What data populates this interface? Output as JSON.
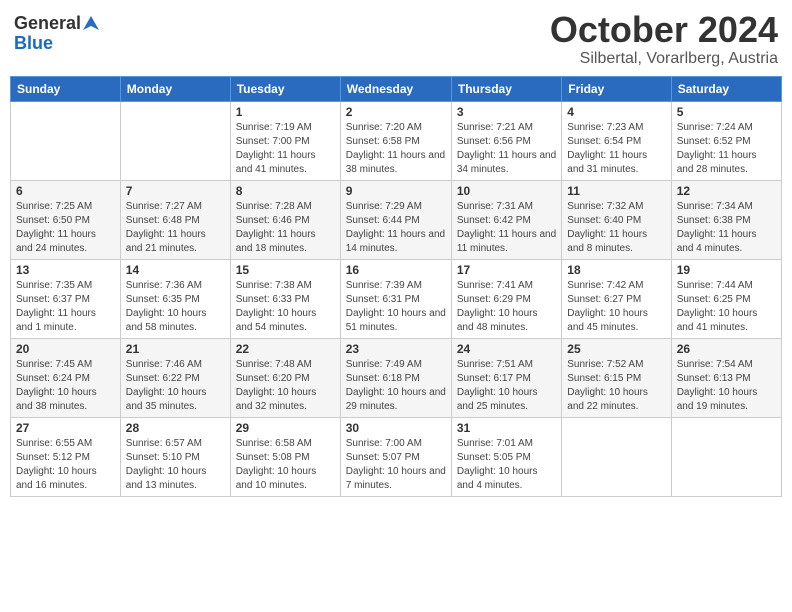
{
  "header": {
    "logo": {
      "general": "General",
      "blue": "Blue"
    },
    "title": "October 2024",
    "subtitle": "Silbertal, Vorarlberg, Austria"
  },
  "calendar": {
    "days_of_week": [
      "Sunday",
      "Monday",
      "Tuesday",
      "Wednesday",
      "Thursday",
      "Friday",
      "Saturday"
    ],
    "weeks": [
      [
        {
          "day": "",
          "detail": ""
        },
        {
          "day": "",
          "detail": ""
        },
        {
          "day": "1",
          "detail": "Sunrise: 7:19 AM\nSunset: 7:00 PM\nDaylight: 11 hours and 41 minutes."
        },
        {
          "day": "2",
          "detail": "Sunrise: 7:20 AM\nSunset: 6:58 PM\nDaylight: 11 hours and 38 minutes."
        },
        {
          "day": "3",
          "detail": "Sunrise: 7:21 AM\nSunset: 6:56 PM\nDaylight: 11 hours and 34 minutes."
        },
        {
          "day": "4",
          "detail": "Sunrise: 7:23 AM\nSunset: 6:54 PM\nDaylight: 11 hours and 31 minutes."
        },
        {
          "day": "5",
          "detail": "Sunrise: 7:24 AM\nSunset: 6:52 PM\nDaylight: 11 hours and 28 minutes."
        }
      ],
      [
        {
          "day": "6",
          "detail": "Sunrise: 7:25 AM\nSunset: 6:50 PM\nDaylight: 11 hours and 24 minutes."
        },
        {
          "day": "7",
          "detail": "Sunrise: 7:27 AM\nSunset: 6:48 PM\nDaylight: 11 hours and 21 minutes."
        },
        {
          "day": "8",
          "detail": "Sunrise: 7:28 AM\nSunset: 6:46 PM\nDaylight: 11 hours and 18 minutes."
        },
        {
          "day": "9",
          "detail": "Sunrise: 7:29 AM\nSunset: 6:44 PM\nDaylight: 11 hours and 14 minutes."
        },
        {
          "day": "10",
          "detail": "Sunrise: 7:31 AM\nSunset: 6:42 PM\nDaylight: 11 hours and 11 minutes."
        },
        {
          "day": "11",
          "detail": "Sunrise: 7:32 AM\nSunset: 6:40 PM\nDaylight: 11 hours and 8 minutes."
        },
        {
          "day": "12",
          "detail": "Sunrise: 7:34 AM\nSunset: 6:38 PM\nDaylight: 11 hours and 4 minutes."
        }
      ],
      [
        {
          "day": "13",
          "detail": "Sunrise: 7:35 AM\nSunset: 6:37 PM\nDaylight: 11 hours and 1 minute."
        },
        {
          "day": "14",
          "detail": "Sunrise: 7:36 AM\nSunset: 6:35 PM\nDaylight: 10 hours and 58 minutes."
        },
        {
          "day": "15",
          "detail": "Sunrise: 7:38 AM\nSunset: 6:33 PM\nDaylight: 10 hours and 54 minutes."
        },
        {
          "day": "16",
          "detail": "Sunrise: 7:39 AM\nSunset: 6:31 PM\nDaylight: 10 hours and 51 minutes."
        },
        {
          "day": "17",
          "detail": "Sunrise: 7:41 AM\nSunset: 6:29 PM\nDaylight: 10 hours and 48 minutes."
        },
        {
          "day": "18",
          "detail": "Sunrise: 7:42 AM\nSunset: 6:27 PM\nDaylight: 10 hours and 45 minutes."
        },
        {
          "day": "19",
          "detail": "Sunrise: 7:44 AM\nSunset: 6:25 PM\nDaylight: 10 hours and 41 minutes."
        }
      ],
      [
        {
          "day": "20",
          "detail": "Sunrise: 7:45 AM\nSunset: 6:24 PM\nDaylight: 10 hours and 38 minutes."
        },
        {
          "day": "21",
          "detail": "Sunrise: 7:46 AM\nSunset: 6:22 PM\nDaylight: 10 hours and 35 minutes."
        },
        {
          "day": "22",
          "detail": "Sunrise: 7:48 AM\nSunset: 6:20 PM\nDaylight: 10 hours and 32 minutes."
        },
        {
          "day": "23",
          "detail": "Sunrise: 7:49 AM\nSunset: 6:18 PM\nDaylight: 10 hours and 29 minutes."
        },
        {
          "day": "24",
          "detail": "Sunrise: 7:51 AM\nSunset: 6:17 PM\nDaylight: 10 hours and 25 minutes."
        },
        {
          "day": "25",
          "detail": "Sunrise: 7:52 AM\nSunset: 6:15 PM\nDaylight: 10 hours and 22 minutes."
        },
        {
          "day": "26",
          "detail": "Sunrise: 7:54 AM\nSunset: 6:13 PM\nDaylight: 10 hours and 19 minutes."
        }
      ],
      [
        {
          "day": "27",
          "detail": "Sunrise: 6:55 AM\nSunset: 5:12 PM\nDaylight: 10 hours and 16 minutes."
        },
        {
          "day": "28",
          "detail": "Sunrise: 6:57 AM\nSunset: 5:10 PM\nDaylight: 10 hours and 13 minutes."
        },
        {
          "day": "29",
          "detail": "Sunrise: 6:58 AM\nSunset: 5:08 PM\nDaylight: 10 hours and 10 minutes."
        },
        {
          "day": "30",
          "detail": "Sunrise: 7:00 AM\nSunset: 5:07 PM\nDaylight: 10 hours and 7 minutes."
        },
        {
          "day": "31",
          "detail": "Sunrise: 7:01 AM\nSunset: 5:05 PM\nDaylight: 10 hours and 4 minutes."
        },
        {
          "day": "",
          "detail": ""
        },
        {
          "day": "",
          "detail": ""
        }
      ]
    ]
  }
}
